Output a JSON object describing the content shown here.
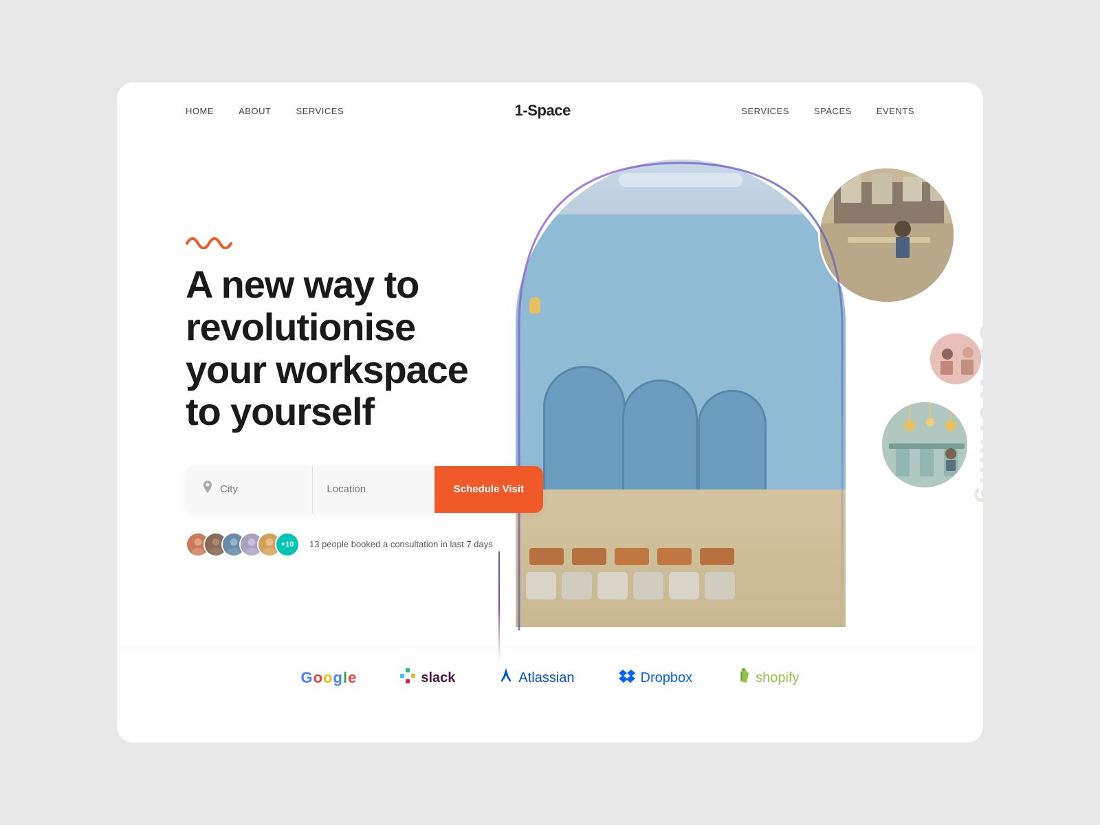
{
  "brand": "1-Space",
  "navbar": {
    "left_links": [
      {
        "label": "HOME",
        "id": "home"
      },
      {
        "label": "ABOUT",
        "id": "about"
      },
      {
        "label": "SERVICES",
        "id": "services-left"
      }
    ],
    "right_links": [
      {
        "label": "SERVICES",
        "id": "services-right"
      },
      {
        "label": "SPACES",
        "id": "spaces"
      },
      {
        "label": "EVENTS",
        "id": "events"
      }
    ]
  },
  "hero": {
    "title_line1": "A new way to",
    "title_line2": "revolutionise",
    "title_line3": "your workspace",
    "title_line4": "to yourself",
    "search": {
      "city_placeholder": "City",
      "location_placeholder": "Location",
      "button_label": "Schedule Visit"
    },
    "social_proof": {
      "count_label": "+10",
      "text": "13 people booked a consultation in last 7 days"
    }
  },
  "coworking_label": "Co Working",
  "brands": [
    {
      "name": "Google",
      "icon": "G",
      "id": "google"
    },
    {
      "name": "slack",
      "icon": "⊞",
      "id": "slack"
    },
    {
      "name": "Atlassian",
      "icon": "⚑",
      "id": "atlassian"
    },
    {
      "name": "Dropbox",
      "icon": "◈",
      "id": "dropbox"
    },
    {
      "name": "shopify",
      "icon": "⬟",
      "id": "shopify"
    }
  ],
  "colors": {
    "accent_orange": "#f05a28",
    "accent_teal": "#00c4b4",
    "arch_border": "url(#archGradient)",
    "nav_text": "#444444",
    "brand_text": "#222222"
  }
}
